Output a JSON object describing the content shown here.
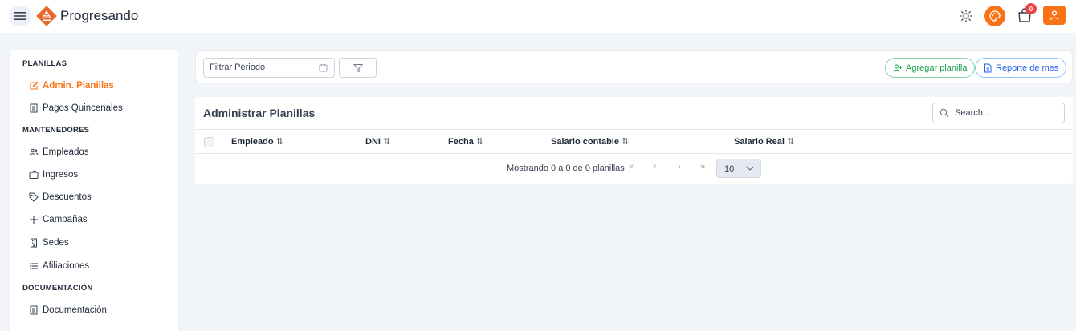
{
  "app": {
    "brand": "Progresando"
  },
  "header": {
    "cart_count": "0"
  },
  "sidebar": {
    "sections": [
      {
        "label": "PLANILLAS",
        "items": [
          {
            "label": "Admin. Planillas",
            "icon": "edit-icon",
            "active": true
          },
          {
            "label": "Pagos Quincenales",
            "icon": "receipt-icon"
          }
        ]
      },
      {
        "label": "MANTENEDORES",
        "items": [
          {
            "label": "Empleados",
            "icon": "users-icon"
          },
          {
            "label": "Ingresos",
            "icon": "wallet-icon"
          },
          {
            "label": "Descuentos",
            "icon": "tag-icon"
          },
          {
            "label": "Campañas",
            "icon": "plus-icon"
          },
          {
            "label": "Sedes",
            "icon": "building-icon"
          },
          {
            "label": "Afiliaciones",
            "icon": "list-icon"
          }
        ]
      },
      {
        "label": "DOCUMENTACIÓN",
        "items": [
          {
            "label": "Documentación",
            "icon": "document-icon"
          }
        ]
      }
    ]
  },
  "toolbar": {
    "period_placeholder": "Filtrar Periodo",
    "add_label": "Agregar planilla",
    "report_label": "Reporte de mes"
  },
  "table": {
    "title": "Administrar Planillas",
    "search_placeholder": "Search...",
    "columns": [
      "Empleado",
      "DNI",
      "Fecha",
      "Salario contable",
      "Salario Real"
    ],
    "sort_glyph": "⇅",
    "rows": [],
    "pagination": {
      "summary": "Mostrando 0 a 0 de 0 planillas",
      "first": "«",
      "prev": "‹",
      "next": "›",
      "last": "»",
      "rows_per_page": "10"
    }
  },
  "colors": {
    "accent": "#f97316",
    "green": "#16a34a",
    "blue": "#2563eb",
    "badge": "#ef4444"
  }
}
